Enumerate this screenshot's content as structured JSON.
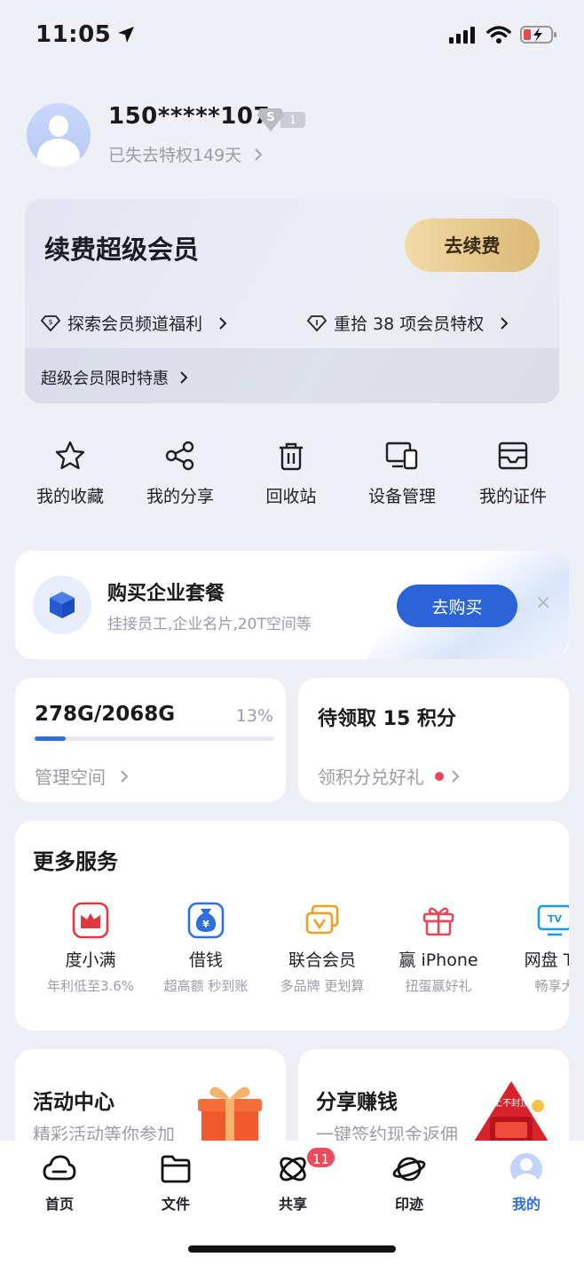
{
  "status_bar": {
    "time": "11:05"
  },
  "profile": {
    "phone": "150*****107",
    "badge_letter": "S",
    "badge_level": "1",
    "expired_text": "已失去特权149天"
  },
  "vip_card": {
    "title": "续费超级会员",
    "renew_button": "去续费",
    "link_left": "探索会员频道福利",
    "link_right": "重拾 38 项会员特权",
    "promo_text": "超级会员限时特惠"
  },
  "shortcuts": [
    {
      "label": "我的收藏",
      "icon": "star-icon"
    },
    {
      "label": "我的分享",
      "icon": "share-icon"
    },
    {
      "label": "回收站",
      "icon": "trash-icon"
    },
    {
      "label": "设备管理",
      "icon": "devices-icon"
    },
    {
      "label": "我的证件",
      "icon": "id-card-icon"
    }
  ],
  "enterprise": {
    "title": "购买企业套餐",
    "subtitle": "挂接员工,企业名片,20T空间等",
    "button": "去购买",
    "close": "×"
  },
  "storage": {
    "value": "278G/2068G",
    "percent_text": "13%",
    "percent": 0.13,
    "link": "管理空间"
  },
  "points": {
    "title": "待领取 15 积分",
    "link": "领积分兑好礼"
  },
  "services": {
    "title": "更多服务",
    "items": [
      {
        "name": "度小满",
        "desc": "年利低至3.6%",
        "icon": "duxiaoman-icon"
      },
      {
        "name": "借钱",
        "desc": "超高额 秒到账",
        "icon": "money-bag-icon"
      },
      {
        "name": "联合会员",
        "desc": "多品牌 更划算",
        "icon": "vip-cards-icon"
      },
      {
        "name": "赢 iPhone",
        "desc": "扭蛋赢好礼",
        "icon": "gift-icon"
      },
      {
        "name": "网盘 TV",
        "desc": "畅享大",
        "icon": "tv-icon"
      }
    ]
  },
  "promos": [
    {
      "title": "活动中心",
      "subtitle": "精彩活动等你参加"
    },
    {
      "title": "分享赚钱",
      "subtitle": "一键签约现金返佣",
      "art_text": "上不封顶"
    }
  ],
  "tabbar": {
    "items": [
      {
        "label": "首页",
        "icon": "cloud-icon"
      },
      {
        "label": "文件",
        "icon": "folder-icon"
      },
      {
        "label": "共享",
        "icon": "atom-icon"
      },
      {
        "label": "印迹",
        "icon": "planet-icon"
      },
      {
        "label": "我的",
        "icon": "avatar-icon"
      }
    ],
    "share_badge": "11",
    "active": "我的"
  },
  "colors": {
    "accent": "#2f6fe0",
    "gold": "#dcb976",
    "badge_red": "#ec4b5c",
    "background": "#eef0f6"
  }
}
